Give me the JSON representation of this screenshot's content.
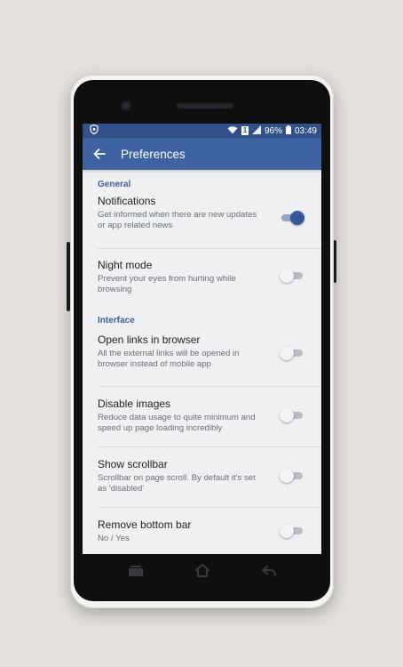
{
  "status_bar": {
    "battery_percent": "96%",
    "time": "03:49",
    "sim_label": "1"
  },
  "toolbar": {
    "title": "Preferences"
  },
  "sections": [
    {
      "header": "General",
      "items": [
        {
          "title": "Notifications",
          "summary": "Get informed when there are new updates or app related news",
          "enabled": true
        },
        {
          "title": "Night mode",
          "summary": "Prevent your eyes from hurting while browsing",
          "enabled": false
        }
      ]
    },
    {
      "header": "Interface",
      "items": [
        {
          "title": "Open links in browser",
          "summary": "All the external links will be opened in browser instead of mobile app",
          "enabled": false
        },
        {
          "title": "Disable images",
          "summary": "Reduce data usage to quite minimum and speed up page loading incredibly",
          "enabled": false
        },
        {
          "title": "Show scrollbar",
          "summary": "Scrollbar on page scroll. By default it's set as 'disabled'",
          "enabled": false
        },
        {
          "title": "Remove bottom bar",
          "summary": "No / Yes",
          "enabled": false
        }
      ]
    }
  ],
  "colors": {
    "status_bar": "#32508a",
    "toolbar": "#3e63a3",
    "accent": "#33589c",
    "section_header": "#3e5f95",
    "background": "#eef0f2"
  },
  "icons": {
    "status_left": "vpn-shield-icon",
    "wifi": "wifi-icon",
    "signal": "signal-icon",
    "battery": "battery-icon",
    "back": "arrow-left-icon",
    "nav_recents": "recent-apps-icon",
    "nav_home": "home-icon",
    "nav_back": "back-icon"
  }
}
